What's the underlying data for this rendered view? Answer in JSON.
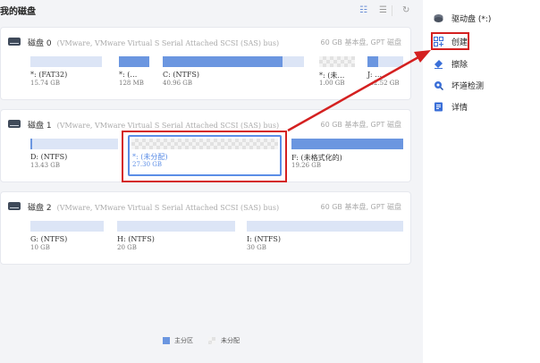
{
  "header": {
    "title": "我的磁盘"
  },
  "toolbar": {
    "list_icon": "list-view-icon",
    "menu_icon": "menu-icon",
    "refresh_icon": "refresh-icon"
  },
  "disks": [
    {
      "name": "磁盘 0",
      "desc": "(VMware, VMware Virtual S Serial Attached SCSI (SAS) bus)",
      "info": "60 GB 基本盘, GPT 磁盘",
      "partitions": [
        {
          "label": "*: (FAT32)",
          "size": "15.74 GB",
          "fill": 0.0
        },
        {
          "label": "*: (…",
          "size": "128 MB",
          "fill": 1.0
        },
        {
          "label": "C: (NTFS)",
          "size": "40.96 GB",
          "fill": 0.85
        },
        {
          "label": "*: (未…",
          "size": "1.00 GB",
          "fill": 0.0
        },
        {
          "label": "J: …",
          "size": "…2.52 GB",
          "fill": 0.3
        }
      ]
    },
    {
      "name": "磁盘 1",
      "desc": "(VMware, VMware Virtual S Serial Attached SCSI (SAS) bus)",
      "info": "60 GB 基本盘, GPT 磁盘",
      "partitions": [
        {
          "label": "D: (NTFS)",
          "size": "13.43 GB",
          "fill": 0.02
        },
        {
          "label": "*: (未分配)",
          "size": "27.30 GB",
          "fill": 0.0
        },
        {
          "label": "F: (未格式化的)",
          "size": "19.26 GB",
          "fill": 1.0
        }
      ]
    },
    {
      "name": "磁盘 2",
      "desc": "(VMware, VMware Virtual S Serial Attached SCSI (SAS) bus)",
      "info": "60 GB 基本盘, GPT 磁盘",
      "partitions": [
        {
          "label": "G: (NTFS)",
          "size": "10 GB",
          "fill": 0.0
        },
        {
          "label": "H: (NTFS)",
          "size": "20 GB",
          "fill": 0.0
        },
        {
          "label": "I: (NTFS)",
          "size": "30 GB",
          "fill": 0.0
        }
      ]
    }
  ],
  "legend": {
    "primary": "主分区",
    "unallocated": "未分配",
    "primary_color": "#6b96e0"
  },
  "sidebar": {
    "items": [
      {
        "label": "驱动盘 (*:)",
        "icon": "drive-icon"
      },
      {
        "label": "创建",
        "icon": "create-icon"
      },
      {
        "label": "擦除",
        "icon": "eraser-icon"
      },
      {
        "label": "坏道检测",
        "icon": "disk-check-icon"
      },
      {
        "label": "详情",
        "icon": "details-icon"
      }
    ]
  },
  "colors": {
    "accent": "#5b8de6",
    "highlight": "#d42020"
  }
}
